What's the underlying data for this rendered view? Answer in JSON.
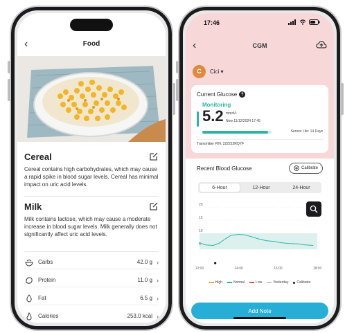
{
  "left_screen": {
    "title": "Food",
    "cereal": {
      "title": "Cereal",
      "text": "Cereal contains high carbohydrates, which may cause a rapid spike in blood sugar levels. Cereal has minimal impact on uric acid levels."
    },
    "milk": {
      "title": "Milk",
      "text": "Milk contains lactose, which may cause a moderate increase in blood sugar levels. Milk generally does not significantly affect uric acid levels."
    },
    "nutrition": [
      {
        "label": "Carbs",
        "value": "42.0 g",
        "icon": "carbs-bowl-icon"
      },
      {
        "label": "Protein",
        "value": "11.0 g",
        "icon": "protein-icon"
      },
      {
        "label": "Fat",
        "value": "6.5 g",
        "icon": "fat-drop-icon"
      },
      {
        "label": "Calories",
        "value": "253.0 kcal",
        "icon": "calories-flame-icon"
      }
    ]
  },
  "right_screen": {
    "status_time": "17:46",
    "title": "CGM",
    "user": {
      "initial": "C",
      "name": "Cici ▾"
    },
    "current_glucose": {
      "title": "Current Glucose",
      "status": "Monitoring",
      "value": "5.2",
      "unit": "mmol/L",
      "timestamp": "Now 11/12/2024 17:45",
      "sensor_life": "Sensor Life: 14 Days",
      "sensor_progress": 0.95,
      "transmitter": "Transmitter PIN: 222222RQYF"
    },
    "recent": {
      "title": "Recent Blood Glucose",
      "calibrate_label": "Calibrate",
      "tabs": [
        "6-Hour",
        "12-Hour",
        "24-Hour"
      ],
      "active_tab": "6-Hour"
    },
    "legend": [
      "High",
      "Normal",
      "Low",
      "Yesterday",
      "Calibrate"
    ],
    "add_note_label": "Add Note"
  },
  "colors": {
    "teal": "#2ab4a2",
    "pink_header": "#f8d7d9",
    "add_note": "#27aed6",
    "high": "#f0a04b",
    "normal": "#2ab4a2",
    "low": "#e2544f",
    "yesterday": "#c8c8c8"
  },
  "chart_data": {
    "type": "line",
    "x_ticks": [
      "12:00",
      "14:00",
      "16:00",
      "18:00"
    ],
    "y_ticks": [
      "20",
      "15",
      "10",
      "5"
    ],
    "ylim": [
      0,
      20
    ],
    "target_range": [
      3.9,
      10.0
    ],
    "grid": true,
    "series": [
      {
        "name": "Normal",
        "x": [
          12.0,
          12.3,
          12.7,
          13.0,
          13.3,
          13.6,
          14.0,
          14.3,
          14.7,
          15.0,
          15.4,
          15.8,
          16.2,
          16.6,
          17.0,
          17.4,
          17.8
        ],
        "y": [
          6.4,
          5.6,
          5.4,
          6.2,
          7.8,
          9.2,
          9.6,
          9.4,
          8.6,
          7.9,
          7.2,
          6.9,
          6.4,
          6.1,
          6.0,
          5.6,
          5.4
        ]
      }
    ],
    "calibrations": [
      {
        "x": 12.8
      }
    ]
  }
}
